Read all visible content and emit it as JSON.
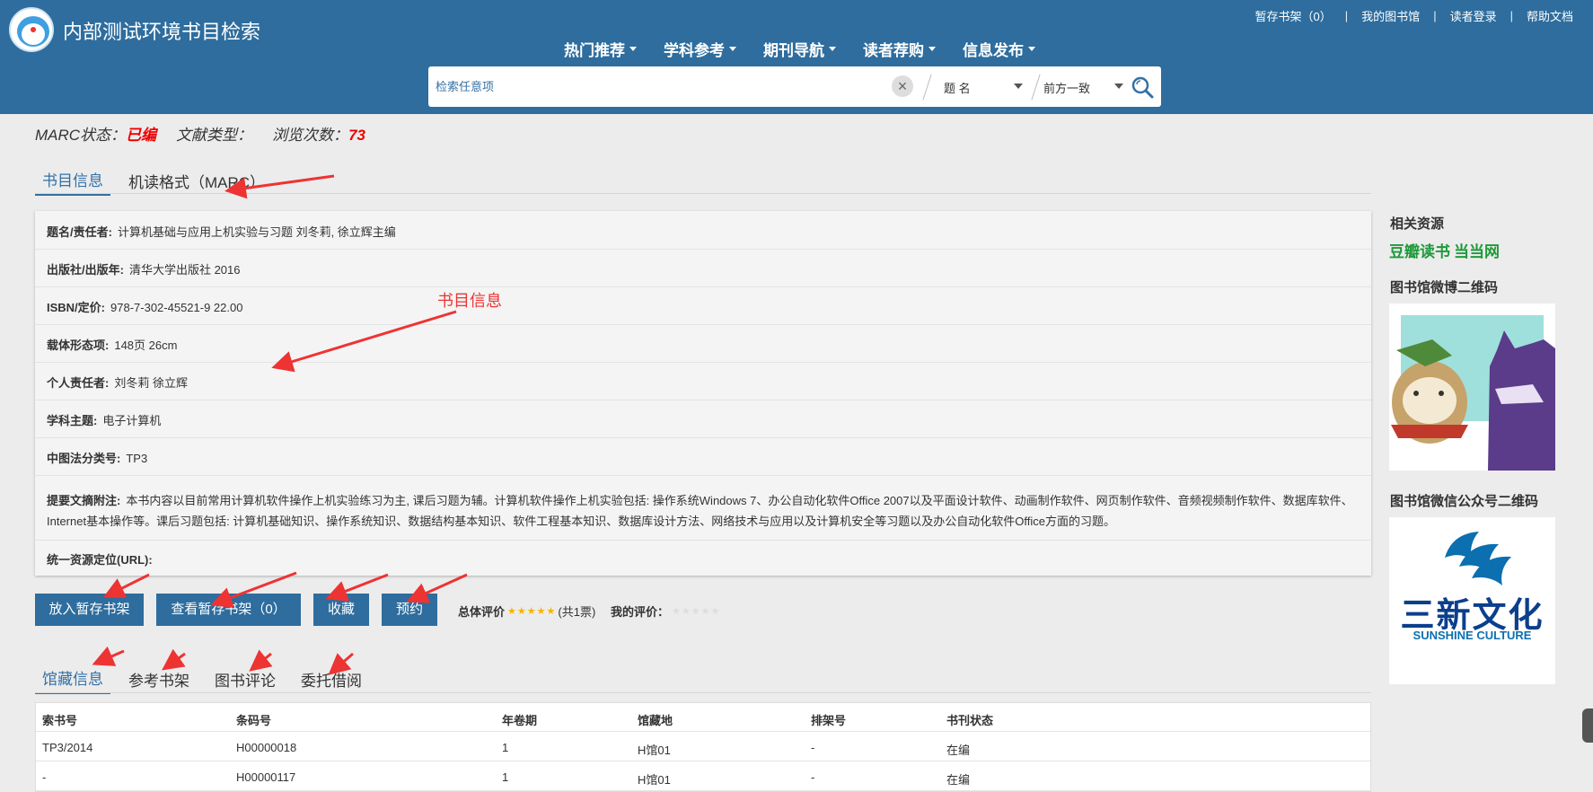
{
  "header": {
    "site_title": "内部测试环境书目检索",
    "top_links": [
      "暂存书架（0）",
      "我的图书馆",
      "读者登录",
      "帮助文档"
    ],
    "nav": [
      "热门推荐",
      "学科参考",
      "期刊导航",
      "读者荐购",
      "信息发布"
    ],
    "search": {
      "placeholder": "检索任意项",
      "field_select": "题 名",
      "match_select": "前方一致"
    }
  },
  "status": {
    "marc_label": "MARC状态：",
    "marc_value": "已编",
    "doc_type_label": "文献类型：",
    "views_label": "浏览次数：",
    "views_value": "73"
  },
  "tabs_top": [
    "书目信息",
    "机读格式（MARC）"
  ],
  "info": {
    "title_label": "题名/责任者:",
    "title_value": "计算机基础与应用上机实验与习题 刘冬莉, 徐立辉主编",
    "publisher_label": "出版社/出版年:",
    "publisher_value": "清华大学出版社 2016",
    "isbn_label": "ISBN/定价:",
    "isbn_value": "978-7-302-45521-9 22.00",
    "form_label": "载体形态项:",
    "form_value": "148页 26cm",
    "person_label": "个人责任者:",
    "person_value": "刘冬莉 徐立辉",
    "subject_label": "学科主题:",
    "subject_value": "电子计算机",
    "clc_label": "中图法分类号:",
    "clc_value": "TP3",
    "abstract_label": "提要文摘附注:",
    "abstract_value": "本书内容以目前常用计算机软件操作上机实验练习为主, 课后习题为辅。计算机软件操作上机实验包括: 操作系统Windows 7、办公自动化软件Office 2007以及平面设计软件、动画制作软件、网页制作软件、音频视频制作软件、数据库软件、Internet基本操作等。课后习题包括: 计算机基础知识、操作系统知识、数据结构基本知识、软件工程基本知识、数据库设计方法、网络技术与应用以及计算机安全等习题以及办公自动化软件Office方面的习题。",
    "url_label": "统一资源定位(URL):"
  },
  "annotation": "书目信息",
  "buttons": {
    "add_shelf": "放入暂存书架",
    "view_shelf": "查看暂存书架（0）",
    "favorite": "收藏",
    "reserve": "预约"
  },
  "rating": {
    "overall_label": "总体评价",
    "overall_stars": 5,
    "votes": "(共1票)",
    "my_label": "我的评价：",
    "my_stars": 0
  },
  "tabs_bottom": [
    "馆藏信息",
    "参考书架",
    "图书评论",
    "委托借阅"
  ],
  "holdings": {
    "headers": [
      "索书号",
      "条码号",
      "年卷期",
      "馆藏地",
      "排架号",
      "书刊状态"
    ],
    "rows": [
      [
        "TP3/2014",
        "H00000018",
        "1",
        "H馆01",
        "-",
        "在编"
      ],
      [
        "-",
        "H00000117",
        "1",
        "H馆01",
        "-",
        "在编"
      ]
    ]
  },
  "sidebar": {
    "related_title": "相关资源",
    "douban_label": "豆瓣读书",
    "dangdang_label": "当当网",
    "weibo_qr_title": "图书馆微博二维码",
    "weixin_qr_title": "图书馆微信公众号二维码",
    "qr2_brand_cn": "三新文化",
    "qr2_brand_en": "SUNSHINE CULTURE"
  },
  "colors": {
    "header_bg": "#2e6d9e",
    "accent": "#3470a4",
    "highlight_red": "#e00000",
    "douban_green": "#1d9a3a"
  }
}
